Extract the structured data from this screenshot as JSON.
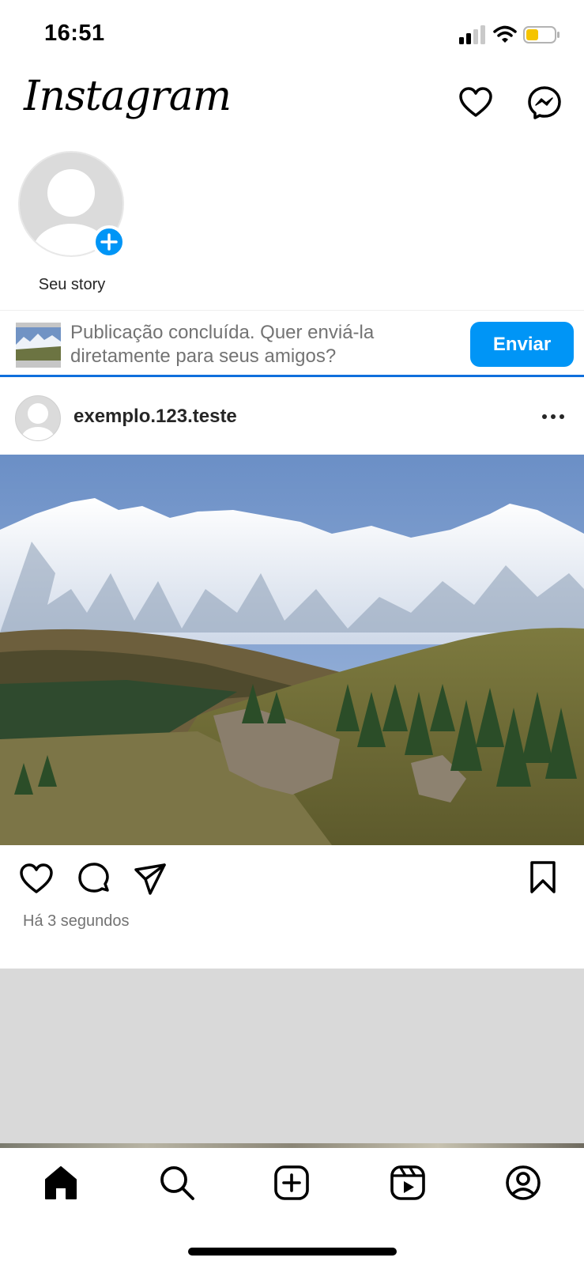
{
  "status_bar": {
    "time": "16:51"
  },
  "header": {
    "logo": "Instagram",
    "icons": [
      "heart-icon",
      "messenger-icon"
    ]
  },
  "stories": {
    "own_label": "Seu story"
  },
  "upload_banner": {
    "message": "Publicação concluída. Quer enviá-la diretamente para seus amigos?",
    "button_label": "Enviar"
  },
  "post": {
    "username": "exemplo.123.teste",
    "timestamp": "Há 3 segundos",
    "image_description": "mountain-landscape"
  },
  "tab_bar": {
    "items": [
      "home-icon",
      "search-icon",
      "create-icon",
      "reels-icon",
      "profile-icon"
    ]
  },
  "colors": {
    "accent": "#0095f6",
    "progress": "#0f6fdc",
    "secondary_text": "#737373",
    "placeholder": "#d9d9d9",
    "battery": "#f5c400"
  }
}
